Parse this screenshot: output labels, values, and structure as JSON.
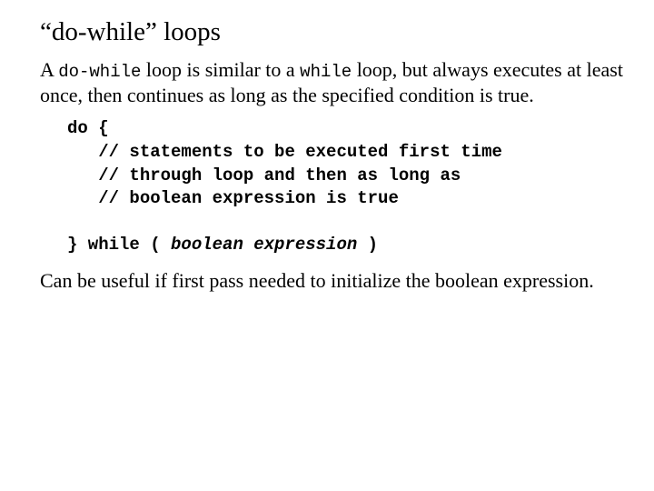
{
  "title": "“do-while” loops",
  "p1": {
    "t1": "A ",
    "c1": "do-while",
    "t2": " loop is similar to a ",
    "c2": "while",
    "t3": " loop, but always executes at least once, then continues as long as the specified condition is true."
  },
  "code": {
    "l1": "do {",
    "l2": "   // statements to be executed first time",
    "l3": "   // through loop and then as long as",
    "l4": "   // boolean expression is true",
    "blank": "",
    "l5a": "} while ( ",
    "l5b": "boolean expression",
    "l5c": " )"
  },
  "p2": "Can be useful if first pass needed to initialize the boolean expression."
}
